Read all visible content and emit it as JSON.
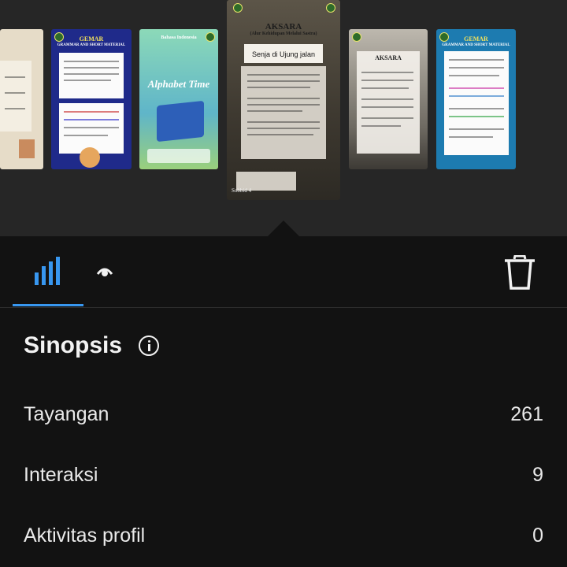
{
  "stories": {
    "s1_title": "GEMAR",
    "s1_sub": "GRAMMAR AND SHORT MATERIAL",
    "s2_title": "Bahasa Indonesia",
    "s2_sub": "Alphabet Time",
    "center_title": "AKSARA",
    "center_sub": "(Alur Kehidupan Melalui Sastra)",
    "center_headline": "Senja di Ujung jalan",
    "center_footer": "Sobbid 4",
    "s4_title": "AKSARA",
    "s4_headline": "Senja di Ujung jalan",
    "s5_title": "GEMAR",
    "s5_sub": "GRAMMAR AND SHORT MATERIAL"
  },
  "tabs": {
    "insights_icon": "bar-chart-icon",
    "viewers_icon": "eye-icon",
    "delete_icon": "trash-icon"
  },
  "summary": {
    "title": "Sinopsis",
    "info_icon": "info-icon",
    "rows": [
      {
        "label": "Tayangan",
        "value": "261"
      },
      {
        "label": "Interaksi",
        "value": "9"
      },
      {
        "label": "Aktivitas profil",
        "value": "0"
      }
    ]
  },
  "colors": {
    "accent": "#3897f0",
    "panel_bg": "#121212",
    "top_bg": "#262626"
  }
}
